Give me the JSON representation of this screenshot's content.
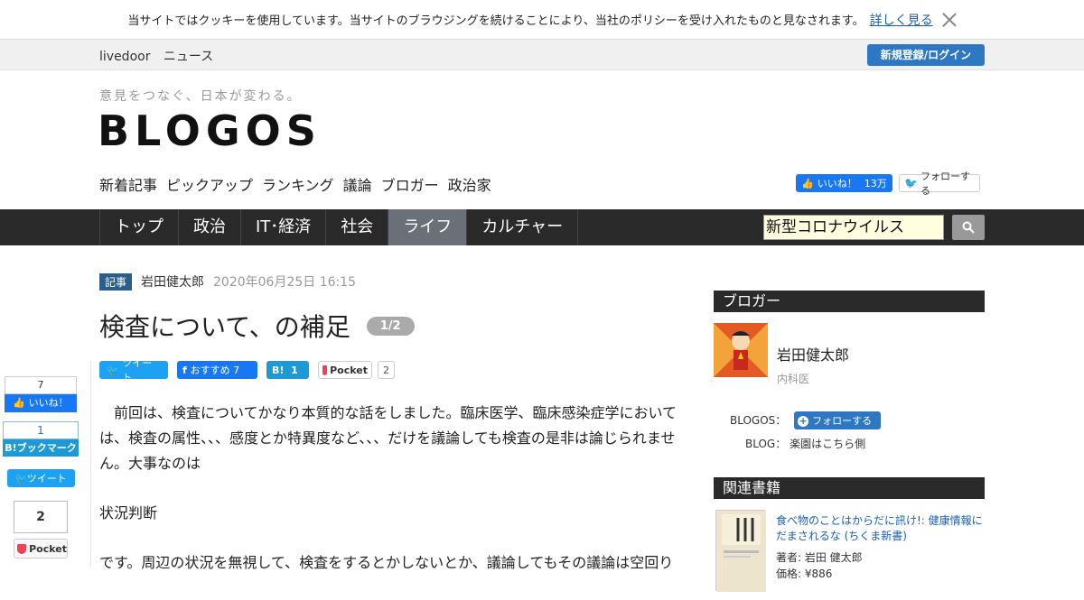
{
  "cookie": {
    "text": "当サイトではクッキーを使用しています。当サイトのブラウジングを続けることにより、当社のポリシーを受け入れたものと見なされます。",
    "link": "詳しく見る"
  },
  "topbar": {
    "brand1": "livedoor",
    "brand2": "ニュース",
    "login": "新規登録/ログイン"
  },
  "header": {
    "tagline": "意見をつなぐ、日本が変わる。",
    "logo": "BLOGOS"
  },
  "subnav": [
    "新着記事",
    "ピックアップ",
    "ランキング",
    "議論",
    "ブロガー",
    "政治家"
  ],
  "social_header": {
    "fb_label": "いいね！",
    "fb_count": "13万",
    "tw_label": "フォローする"
  },
  "mainnav": {
    "items": [
      "トップ",
      "政治",
      "IT･経済",
      "社会",
      "ライフ",
      "カルチャー"
    ],
    "active_index": 4,
    "search_value": "新型コロナウイルス"
  },
  "article": {
    "tag": "記事",
    "author": "岩田健太郎",
    "date": "2020年06月25日 16:15",
    "title": "検査について、の補足",
    "pages": "1/2",
    "paragraphs": [
      "　前回は、検査についてかなり本質的な話をしました。臨床医学、臨床感染症学においては、検査の属性、、、感度とか特異度など、、、だけを議論しても検査の是非は論じられません。大事なのは",
      "状況判断",
      "です。周辺の状況を無視して、検査をするとかしないとか、議論してもその議論は空回り"
    ]
  },
  "share": {
    "tweet": "ツイート",
    "fb_label": "おすすめ",
    "fb_count": "7",
    "hb_count": "1",
    "pocket": "Pocket",
    "pocket_count": "2"
  },
  "leftshare": {
    "fb_count": "7",
    "fb_label": "いいね！",
    "hb_count": "1",
    "hb_label": "B!ブックマーク",
    "tweet": "ツイート",
    "pocket_count": "2",
    "pocket": "Pocket"
  },
  "sidebar": {
    "blogger_head": "ブロガー",
    "blogger_name": "岩田健太郎",
    "blogger_job": "内科医",
    "blogos_label": "BLOGOS：",
    "follow": "フォローする",
    "blog_label": "BLOG：",
    "blog_name": "楽園はこちら側",
    "books_head": "関連書籍",
    "book_title": "食べ物のことはからだに訊け!: 健康情報にだまされるな (ちくま新書)",
    "book_author": "著者: 岩田 健太郎",
    "book_price": "価格: ¥886"
  },
  "colors": {
    "accent": "#2e77c2",
    "nav_bg": "#2a2a2a",
    "nav_active": "#6b6f78"
  }
}
